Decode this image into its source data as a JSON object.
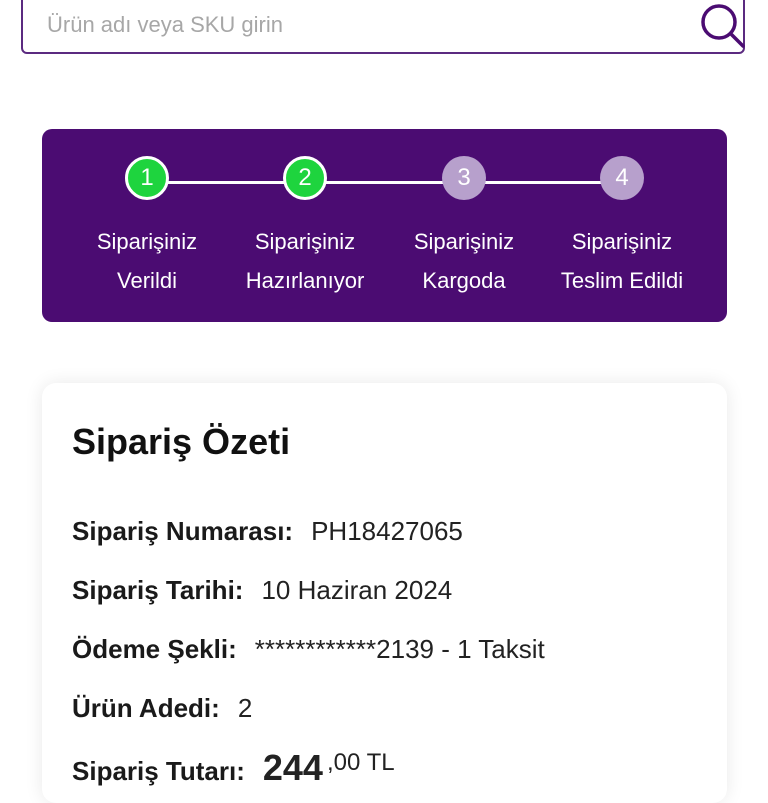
{
  "search": {
    "placeholder": "Ürün adı veya SKU girin"
  },
  "colors": {
    "brand_purple": "#4b0c72",
    "step_done": "#1ed43e",
    "step_pending": "#b7a0cc"
  },
  "tracker": {
    "steps": [
      {
        "number": "1",
        "line1": "Siparişiniz",
        "line2": "Verildi",
        "status": "done"
      },
      {
        "number": "2",
        "line1": "Siparişiniz",
        "line2": "Hazırlanıyor",
        "status": "done"
      },
      {
        "number": "3",
        "line1": "Siparişiniz",
        "line2": "Kargoda",
        "status": "pending"
      },
      {
        "number": "4",
        "line1": "Siparişiniz",
        "line2": "Teslim Edildi",
        "status": "pending"
      }
    ]
  },
  "summary": {
    "title": "Sipariş Özeti",
    "order_number_label": "Sipariş Numarası:",
    "order_number": "PH18427065",
    "order_date_label": "Sipariş Tarihi:",
    "order_date": "10 Haziran 2024",
    "payment_label": "Ödeme Şekli:",
    "payment": "************2139 - 1 Taksit",
    "quantity_label": "Ürün Adedi:",
    "quantity": "2",
    "total_label": "Sipariş Tutarı:",
    "total_main": "244",
    "total_cents": ",00 TL"
  }
}
